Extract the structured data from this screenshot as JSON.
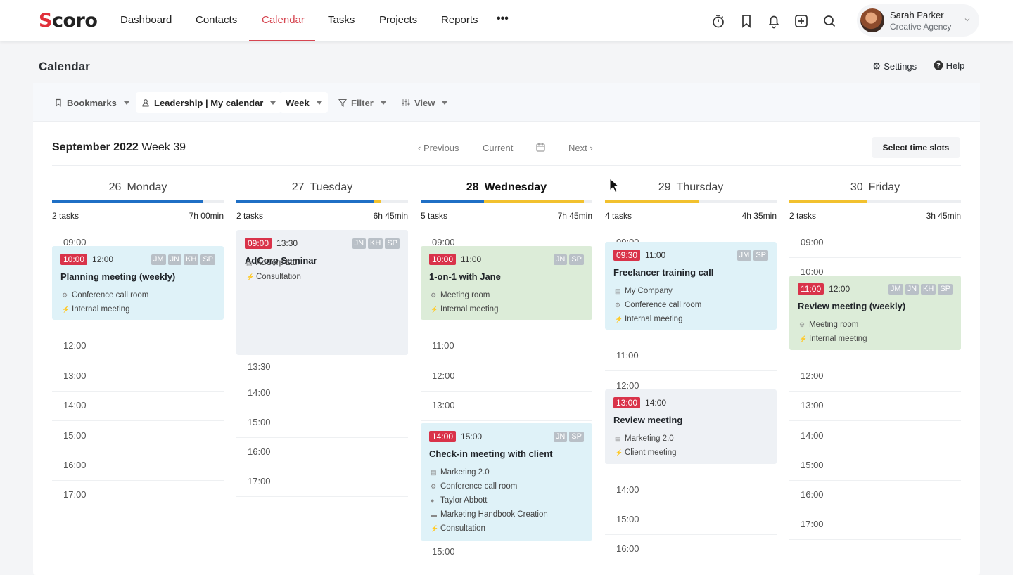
{
  "app": {
    "logo_prefix": "S",
    "logo_rest": "coro"
  },
  "nav": {
    "items": [
      "Dashboard",
      "Contacts",
      "Calendar",
      "Tasks",
      "Projects",
      "Reports"
    ],
    "more": "•••",
    "active": "Calendar"
  },
  "topicons": [
    "timer-icon",
    "bookmark-icon",
    "bell-icon",
    "add-icon",
    "search-icon"
  ],
  "user": {
    "name": "Sarah Parker",
    "org": "Creative Agency"
  },
  "page": {
    "title": "Calendar",
    "settings": "Settings",
    "help": "Help"
  },
  "toolbar": {
    "bookmarks": "Bookmarks",
    "calendar": "Leadership | My calendar",
    "range": "Week",
    "filter": "Filter",
    "view": "View"
  },
  "week": {
    "month": "September 2022",
    "week": "Week 39",
    "previous": "Previous",
    "current": "Current",
    "next": "Next",
    "select": "Select time slots"
  },
  "colors": {
    "accent": "#d64651",
    "blue": "#1f6fc5",
    "yellow": "#f2c12e",
    "badge": "#d9334a"
  },
  "days": [
    {
      "num": "26",
      "name": "Monday",
      "tasks": "2 tasks",
      "duration": "7h 00min",
      "progress": [
        {
          "color": "#1f6fc5",
          "start": 0,
          "end": 0.88
        }
      ]
    },
    {
      "num": "27",
      "name": "Tuesday",
      "tasks": "2 tasks",
      "duration": "6h 45min",
      "progress": [
        {
          "color": "#1f6fc5",
          "start": 0,
          "end": 0.8
        },
        {
          "color": "#f2c12e",
          "start": 0.8,
          "end": 0.84
        }
      ]
    },
    {
      "num": "28",
      "name": "Wednesday",
      "tasks": "5 tasks",
      "duration": "7h 45min",
      "today": true,
      "progress": [
        {
          "color": "#1f6fc5",
          "start": 0,
          "end": 0.37
        },
        {
          "color": "#f2c12e",
          "start": 0.37,
          "end": 0.95
        }
      ]
    },
    {
      "num": "29",
      "name": "Thursday",
      "tasks": "4 tasks",
      "duration": "4h 35min",
      "progress": [
        {
          "color": "#f2c12e",
          "start": 0,
          "end": 0.55
        }
      ]
    },
    {
      "num": "30",
      "name": "Friday",
      "tasks": "2 tasks",
      "duration": "3h 45min",
      "progress": [
        {
          "color": "#f2c12e",
          "start": 0,
          "end": 0.45
        }
      ]
    }
  ],
  "events": [
    {
      "day": 0,
      "start": "10:00",
      "end": "12:00",
      "title": "Planning meeting (weekly)",
      "initials": [
        "JM",
        "JN",
        "KH",
        "SP"
      ],
      "meta": [
        {
          "icon": "room",
          "text": "Conference call room"
        },
        {
          "icon": "type",
          "text": "Internal meeting"
        }
      ]
    },
    {
      "day": 1,
      "start": "09:00",
      "end": "13:30",
      "title": "AdCorp Seminar",
      "initials": [
        "JN",
        "KH",
        "SP"
      ],
      "meta": [
        {
          "icon": "project",
          "text": "AdCorp Ltd."
        },
        {
          "icon": "type",
          "text": "Consultation"
        }
      ]
    },
    {
      "day": 2,
      "start": "10:00",
      "end": "11:00",
      "title": "1-on-1 with Jane",
      "initials": [
        "JN",
        "SP"
      ],
      "meta": [
        {
          "icon": "room",
          "text": "Meeting room"
        },
        {
          "icon": "type",
          "text": "Internal meeting"
        }
      ]
    },
    {
      "day": 2,
      "start": "14:00",
      "end": "15:00",
      "title": "Check-in meeting with client",
      "initials": [
        "JN",
        "SP"
      ],
      "meta": [
        {
          "icon": "project",
          "text": "Marketing 2.0"
        },
        {
          "icon": "room",
          "text": "Conference call room"
        },
        {
          "icon": "person",
          "text": "Taylor Abbott"
        },
        {
          "icon": "folder",
          "text": "Marketing Handbook Creation"
        },
        {
          "icon": "type",
          "text": "Consultation"
        }
      ]
    },
    {
      "day": 3,
      "start": "09:30",
      "end": "11:00",
      "title": "Freelancer training call",
      "initials": [
        "JM",
        "SP"
      ],
      "meta": [
        {
          "icon": "project",
          "text": "My Company"
        },
        {
          "icon": "room",
          "text": "Conference call room"
        },
        {
          "icon": "type",
          "text": "Internal meeting"
        }
      ]
    },
    {
      "day": 3,
      "start": "13:00",
      "end": "14:00",
      "title": "Review meeting",
      "initials": [],
      "meta": [
        {
          "icon": "project",
          "text": "Marketing 2.0"
        },
        {
          "icon": "type",
          "text": "Client meeting"
        }
      ]
    },
    {
      "day": 4,
      "start": "11:00",
      "end": "12:00",
      "title": "Review meeting (weekly)",
      "initials": [
        "JM",
        "JN",
        "KH",
        "SP"
      ],
      "meta": [
        {
          "icon": "room",
          "text": "Meeting room"
        },
        {
          "icon": "type",
          "text": "Internal meeting"
        }
      ]
    }
  ],
  "slots": [
    [
      "09:00",
      "12:00",
      "13:00",
      "14:00",
      "15:00",
      "16:00",
      "17:00"
    ],
    [
      "13:30",
      "14:00",
      "15:00",
      "16:00",
      "17:00"
    ],
    [
      "09:00",
      "11:00",
      "12:00",
      "13:00",
      "15:00"
    ],
    [
      "09:00",
      "11:00",
      "12:00",
      "14:00",
      "15:00",
      "16:00"
    ],
    [
      "09:00",
      "10:00",
      "12:00",
      "13:00",
      "14:00",
      "15:00",
      "16:00",
      "17:00"
    ]
  ]
}
